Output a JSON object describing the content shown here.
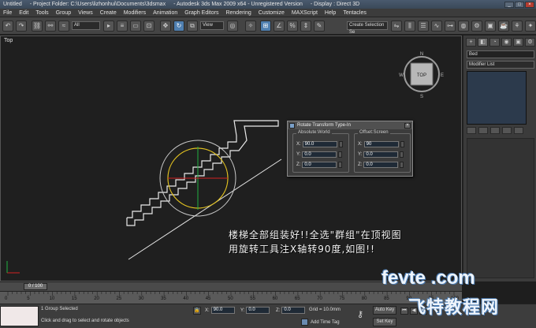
{
  "window": {
    "title_segments": [
      "Untitled",
      "- Project Folder: C:\\Users\\lizhonhui\\Documents\\3dsmax",
      "- Autodesk 3ds Max  2009 x64  - Unregistered Version",
      "- Display : Direct 3D"
    ],
    "controls": [
      "_",
      "□",
      "×"
    ]
  },
  "menu": [
    "File",
    "Edit",
    "Tools",
    "Group",
    "Views",
    "Create",
    "Modifiers",
    "Animation",
    "Graph Editors",
    "Rendering",
    "Customize",
    "MAXScript",
    "Help",
    "Tentacles"
  ],
  "toolbar": {
    "selection_filter": "All",
    "reference_coord": "View",
    "named_selection": "Create Selection Se"
  },
  "viewport": {
    "label": "Top",
    "viewcube_label": "TOP",
    "compass": [
      "N",
      "S",
      "W",
      "E"
    ]
  },
  "command_panel": {
    "tabs": [
      "+",
      "◧",
      "◔",
      "◉",
      "▣",
      "⚙"
    ],
    "object_name": "Bed",
    "modifier_list": "Modifier List"
  },
  "dialog": {
    "title": "Rotate Transform Type-In",
    "close": "×",
    "absolute": {
      "title": "Absolute:World",
      "fields": [
        {
          "axis": "X:",
          "value": "90.0"
        },
        {
          "axis": "Y:",
          "value": "0.0"
        },
        {
          "axis": "Z:",
          "value": "0.0"
        }
      ]
    },
    "offset": {
      "title": "Offset:Screen",
      "fields": [
        {
          "axis": "X:",
          "value": "90"
        },
        {
          "axis": "Y:",
          "value": "0.0"
        },
        {
          "axis": "Z:",
          "value": "0.0"
        }
      ]
    }
  },
  "annotation": {
    "line1": "楼梯全部组装好!!全选\"群组\"在顶视图",
    "line2": "用旋转工具注X轴转90度,如图!!"
  },
  "timeline": {
    "frame_display": "0 / 100",
    "ticks": [
      "0",
      "5",
      "10",
      "15",
      "20",
      "25",
      "30",
      "35",
      "40",
      "45",
      "50",
      "55",
      "60",
      "65",
      "70",
      "75",
      "80",
      "85",
      "90",
      "95",
      "100"
    ]
  },
  "status": {
    "selection": "1 Group Selected",
    "prompt": "Click and drag to select and rotate objects",
    "coords": [
      {
        "axis": "X:",
        "value": "90.0"
      },
      {
        "axis": "Y:",
        "value": "0.0"
      },
      {
        "axis": "Z:",
        "value": "0.0"
      }
    ],
    "grid": "Grid = 10.0mm",
    "add_time_tag": "Add Time Tag",
    "auto_key": "Auto Key",
    "set_key": "Set Key"
  },
  "watermark": {
    "line1": "fevte .com",
    "line2": "飞特教程网"
  },
  "colors": {
    "selection_circle": "#e0c020",
    "outline": "#e8e8e8",
    "axis_red": "#d02020",
    "axis_green": "#20b040",
    "active_tool": "#4f7fb0"
  }
}
